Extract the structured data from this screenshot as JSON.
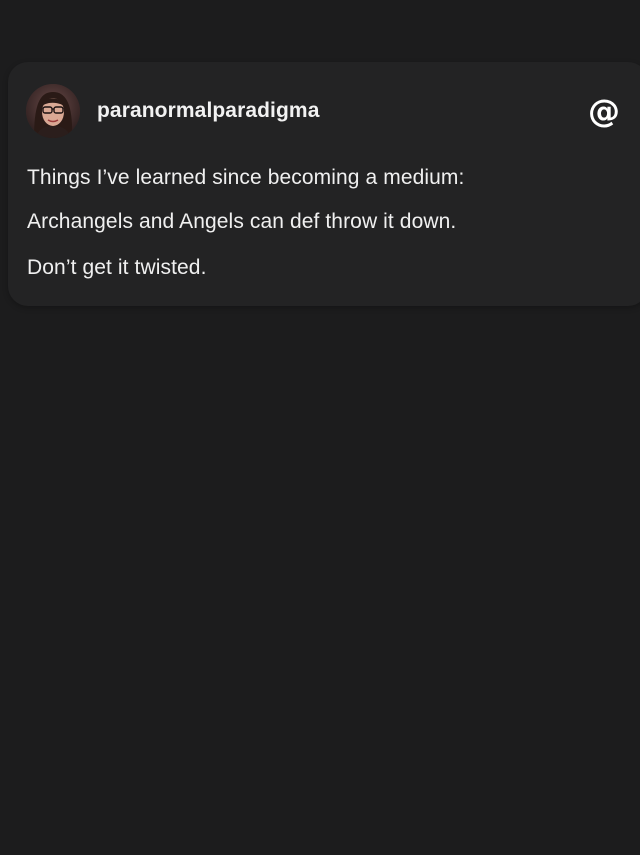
{
  "post": {
    "author": {
      "username": "paranormalparadigma",
      "avatar_icon": "profile-photo"
    },
    "brand_icon": "threads-logo-icon",
    "lines": [
      "Things I’ve learned since becoming a medium:",
      "Archangels and Angels can def throw it down.",
      "Don’t get it twisted."
    ]
  },
  "colors": {
    "background": "#1c1c1d",
    "card": "#232324",
    "text": "#f0f0f0"
  }
}
